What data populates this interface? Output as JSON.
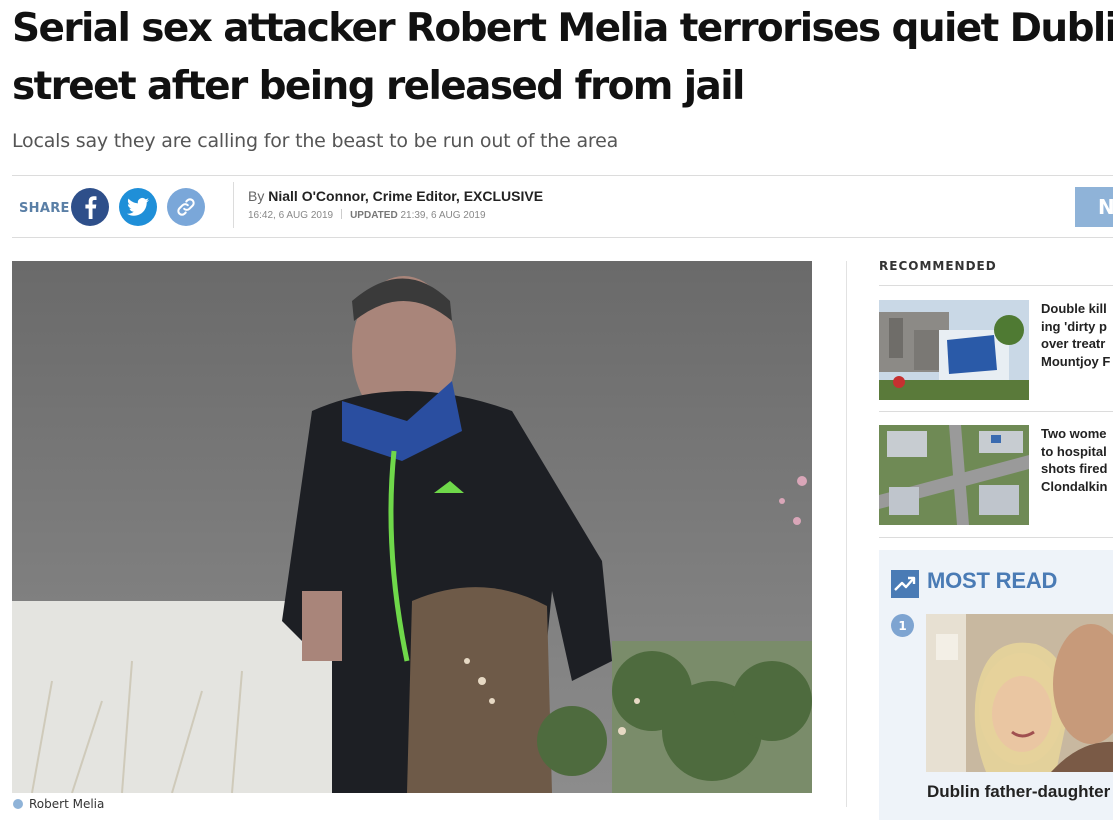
{
  "article": {
    "headline": "Serial sex attacker Robert Melia terrorises quiet Dublin street after being released from jail",
    "standfirst": "Locals say they are calling for the beast to be run out of the area",
    "share_label": "SHARE",
    "byline_prefix": "By",
    "byline_author": "Niall O'Connor, Crime Editor, EXCLUSIVE",
    "published": "16:42, 6 AUG 2019",
    "updated_label": "UPDATED",
    "updated": "21:39, 6 AUG 2019",
    "top_button_label": "N",
    "photo_caption": "Robert Melia"
  },
  "share_buttons": [
    {
      "icon": "facebook-icon",
      "color": "#2e4f8a"
    },
    {
      "icon": "twitter-icon",
      "color": "#1f8fd8"
    },
    {
      "icon": "link-icon",
      "color": "#7aa7d9"
    }
  ],
  "sidebar": {
    "recommended_heading": "RECOMMENDED",
    "recommended": [
      {
        "title": "Double kill\ning 'dirty p\nover treatr\nMountjoy F"
      },
      {
        "title": "Two wome\nto hospital\nshots fired\nClondalkin"
      }
    ],
    "most_read_heading": "MOST READ",
    "most_read": [
      {
        "rank": "1",
        "title": "Dublin father-daughter"
      }
    ]
  },
  "colors": {
    "accent": "#4a7bb5",
    "facebook": "#2e4f8a",
    "twitter": "#1f8fd8"
  }
}
